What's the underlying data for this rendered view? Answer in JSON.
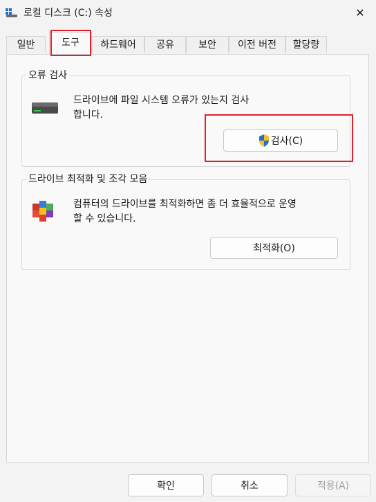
{
  "window": {
    "title": "로컬 디스크 (C:) 속성",
    "close_glyph": "✕"
  },
  "tabs": [
    {
      "label": "일반"
    },
    {
      "label": "도구"
    },
    {
      "label": "하드웨어"
    },
    {
      "label": "공유"
    },
    {
      "label": "보안"
    },
    {
      "label": "이전 버전"
    },
    {
      "label": "할당량"
    }
  ],
  "active_tab": "도구",
  "error_check": {
    "group_title": "오류 검사",
    "description": "드라이브에 파일 시스템 오류가 있는지 검사\n합니다.",
    "button_label": "검사(C)"
  },
  "optimize": {
    "group_title": "드라이브 최적화 및 조각 모음",
    "description": "컴퓨터의 드라이브를 최적화하면 좀 더 효율적으로 운영\n할 수 있습니다.",
    "button_label": "최적화(O)"
  },
  "footer": {
    "ok_label": "확인",
    "cancel_label": "취소",
    "apply_label": "적용(A)"
  },
  "colors": {
    "accent": "#2a6bd1",
    "annotation": "#e0202a"
  }
}
